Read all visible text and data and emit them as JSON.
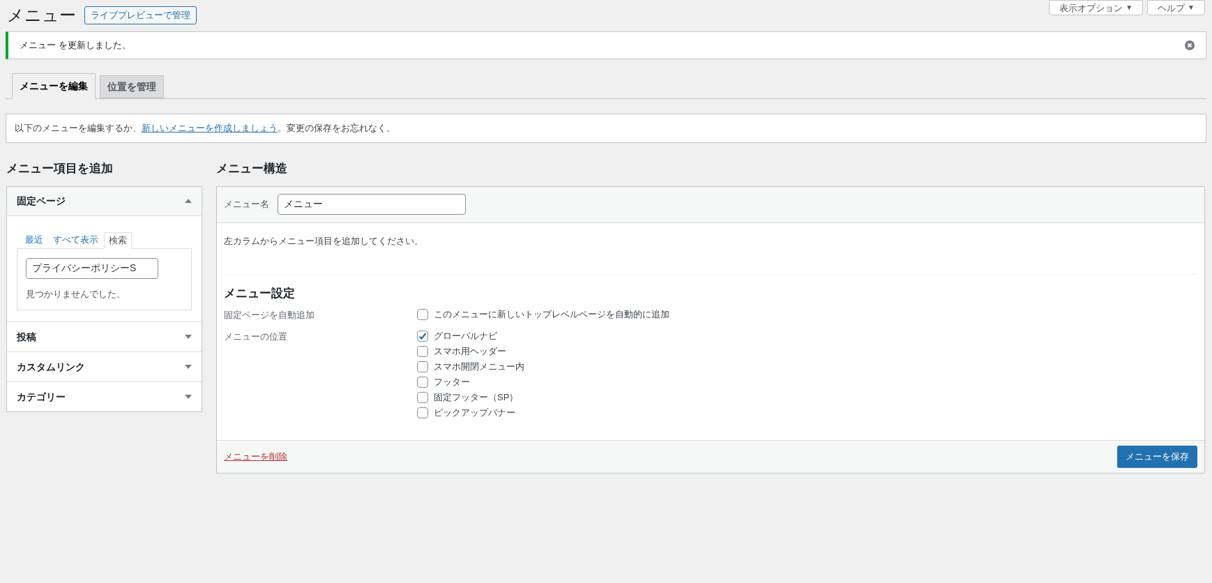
{
  "page_title": "メニュー",
  "live_preview_button": "ライブプレビューで管理",
  "screen_buttons": [
    {
      "label": "表示オプション",
      "caret": "▼"
    },
    {
      "label": "ヘルプ",
      "caret": "▼"
    }
  ],
  "notice": {
    "message": "メニュー を更新しました。"
  },
  "tabs": [
    {
      "label": "メニューを編集",
      "selected": true
    },
    {
      "label": "位置を管理",
      "selected": false
    }
  ],
  "info": {
    "before": "以下のメニューを編集するか、",
    "link": "新しいメニューを作成しましょう",
    "after": "。変更の保存をお忘れなく。"
  },
  "add_items": {
    "heading": "メニュー項目を追加",
    "sections": [
      {
        "title": "固定ページ",
        "expanded": true,
        "subtabs": [
          {
            "label": "最近",
            "selected": false
          },
          {
            "label": "すべて表示",
            "selected": false
          },
          {
            "label": "検索",
            "selected": true
          }
        ],
        "search_value": "プライバシーポリシーS",
        "result": "見つかりませんでした。"
      },
      {
        "title": "投稿",
        "expanded": false
      },
      {
        "title": "カスタムリンク",
        "expanded": false
      },
      {
        "title": "カテゴリー",
        "expanded": false
      }
    ]
  },
  "structure": {
    "heading": "メニュー構造",
    "name_label": "メニュー名",
    "name_value": "メニュー",
    "hint": "左カラムからメニュー項目を追加してください。",
    "settings_heading": "メニュー設定",
    "settings": [
      {
        "label": "固定ページを自動追加",
        "options": [
          {
            "label": "このメニューに新しいトップレベルページを自動的に追加",
            "checked": false
          }
        ]
      },
      {
        "label": "メニューの位置",
        "options": [
          {
            "label": "グローバルナビ",
            "checked": true
          },
          {
            "label": "スマホ用ヘッダー",
            "checked": false
          },
          {
            "label": "スマホ開閉メニュー内",
            "checked": false
          },
          {
            "label": "フッター",
            "checked": false
          },
          {
            "label": "固定フッター（SP）",
            "checked": false
          },
          {
            "label": "ピックアップバナー",
            "checked": false
          }
        ]
      }
    ],
    "delete_link": "メニューを削除",
    "save_button": "メニューを保存"
  }
}
